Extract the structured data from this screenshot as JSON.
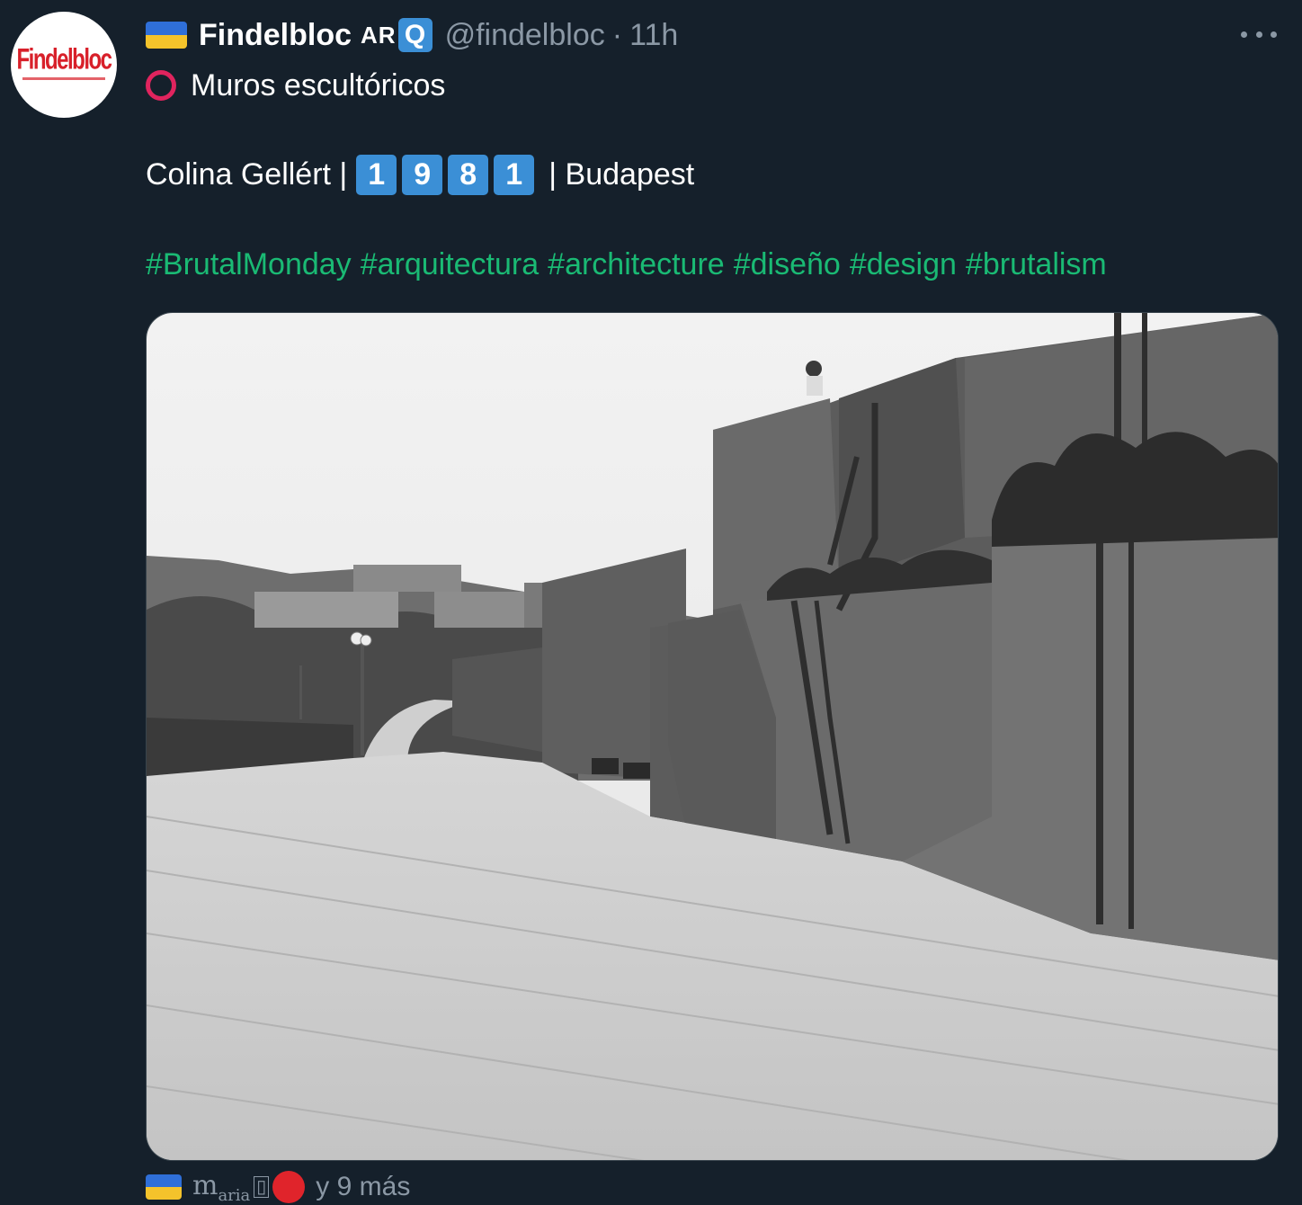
{
  "author": {
    "display_name": "Findelbloc",
    "badge_text": "AR",
    "badge_box": "Q",
    "handle": "@findelbloc",
    "separator": "·",
    "time": "11h",
    "avatar_logo_text": "Findelbloc",
    "flag_icon": "ukraine-flag-icon"
  },
  "tweet": {
    "line1_icon": "red-circle-icon",
    "line1_text": "Muros escultóricos",
    "line2_prefix": "Colina Gellért |",
    "year_digits": [
      "1",
      "9",
      "8",
      "1"
    ],
    "line2_suffix": "| Budapest",
    "hashtags": [
      "#BrutalMonday",
      "#arquitectura",
      "#architecture",
      "#diseño",
      "#design",
      "#brutalism"
    ]
  },
  "media": {
    "description_icon": "photo-image"
  },
  "likes_row": {
    "name_fragment": "m",
    "name_sub": "aria",
    "tofu_glyph": "▯",
    "more_text": "y 9 más"
  },
  "colors": {
    "background": "#15202b",
    "hashtag": "#1aba74",
    "muted": "#8b98a5",
    "keycap": "#3b8fd6",
    "red": "#e0245e"
  }
}
